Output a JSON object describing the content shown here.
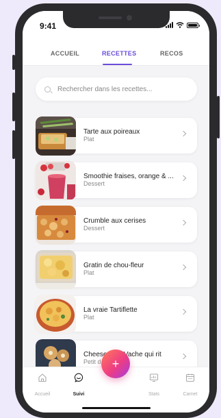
{
  "status": {
    "time": "9:41"
  },
  "tabs": [
    {
      "label": "ACCUEIL"
    },
    {
      "label": "RECETTES",
      "active": true
    },
    {
      "label": "RECOS"
    }
  ],
  "search": {
    "placeholder": "Rechercher dans les recettes...",
    "value": ""
  },
  "recipes": [
    {
      "title": "Tarte aux poireaux",
      "category": "Plat"
    },
    {
      "title": "Smoothie fraises, orange & ...",
      "category": "Dessert"
    },
    {
      "title": "Crumble aux cerises",
      "category": "Dessert"
    },
    {
      "title": "Gratin de chou-fleur",
      "category": "Plat"
    },
    {
      "title": "La vraie Tartiflette",
      "category": "Plat"
    },
    {
      "title": "Cheese ... la Vache qui rit",
      "category": "Petit d... entrée"
    }
  ],
  "bottom_nav": [
    {
      "label": "Accueil",
      "icon": "home-icon"
    },
    {
      "label": "Suivi",
      "icon": "chat-icon",
      "active": true
    },
    {
      "label": "Stats",
      "icon": "stats-icon"
    },
    {
      "label": "Carnet",
      "icon": "calendar-icon"
    }
  ],
  "fab": {
    "label": "+"
  },
  "colors": {
    "accent": "#6a4dd8",
    "background": "#efeafb"
  }
}
